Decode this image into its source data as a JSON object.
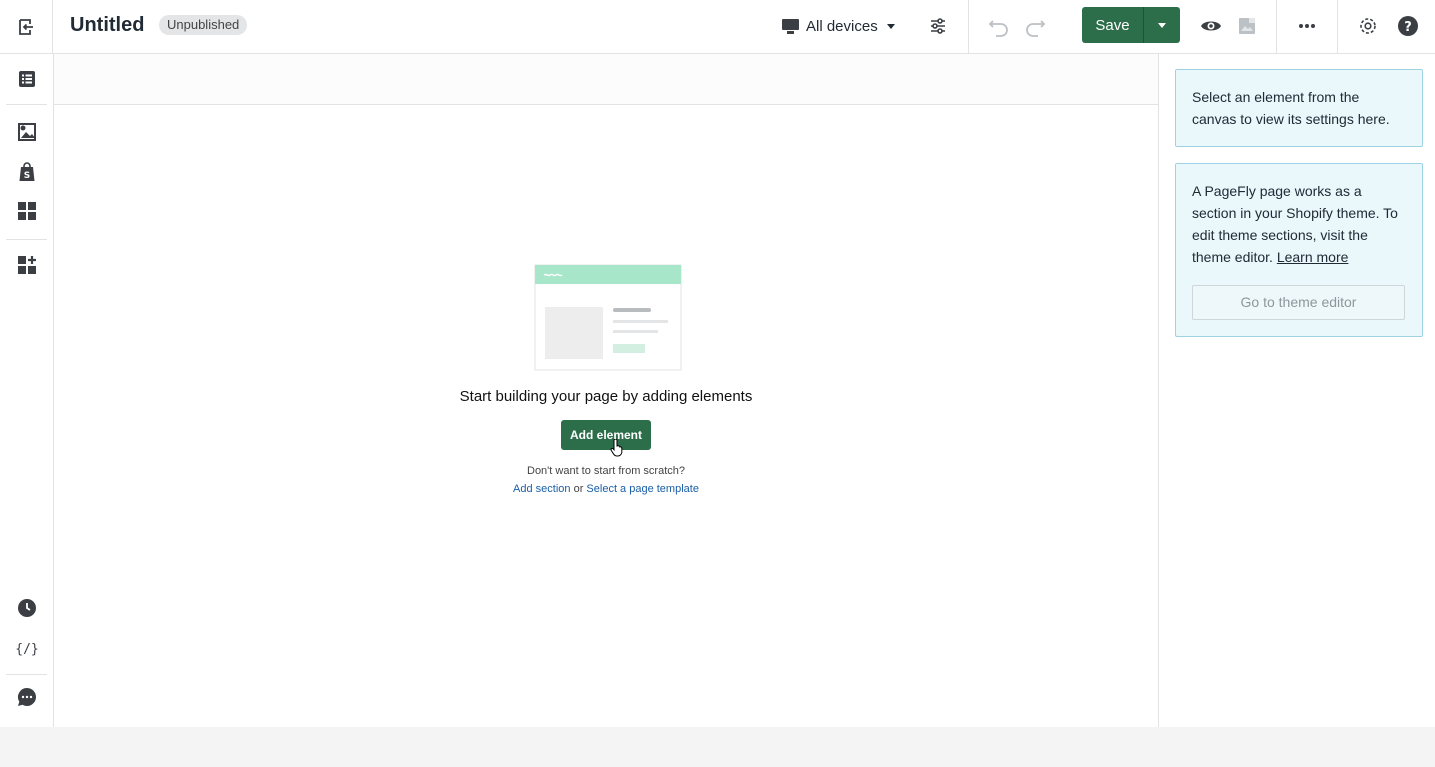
{
  "header": {
    "title": "Untitled",
    "status_badge": "Unpublished",
    "device_label": "All devices",
    "save_label": "Save"
  },
  "canvas": {
    "empty_title": "Start building your page by adding elements",
    "add_button": "Add element",
    "scratch_text": "Don't want to start from scratch?",
    "add_section_link": "Add section",
    "or_text": "or",
    "template_link": "Select a page template"
  },
  "right_panel": {
    "select_hint": "Select an element from the canvas to view its settings here.",
    "info_text": "A PageFly page works as a section in your Shopify theme. To edit theme sections, visit the theme editor.",
    "learn_more": "Learn more",
    "theme_editor_button": "Go to theme editor"
  },
  "sidebar": {
    "items": [
      {
        "icon": "list-icon"
      },
      {
        "icon": "media-icon"
      },
      {
        "icon": "shopify-bag-icon"
      },
      {
        "icon": "grid-icon"
      },
      {
        "icon": "add-grid-icon"
      },
      {
        "icon": "clock-icon"
      },
      {
        "icon": "code-icon"
      },
      {
        "icon": "chat-icon"
      }
    ]
  },
  "colors": {
    "accent": "#2c6e49",
    "info_bg": "#eaf7fb",
    "info_border": "#9ed3e4",
    "link": "#1a5fa8"
  }
}
